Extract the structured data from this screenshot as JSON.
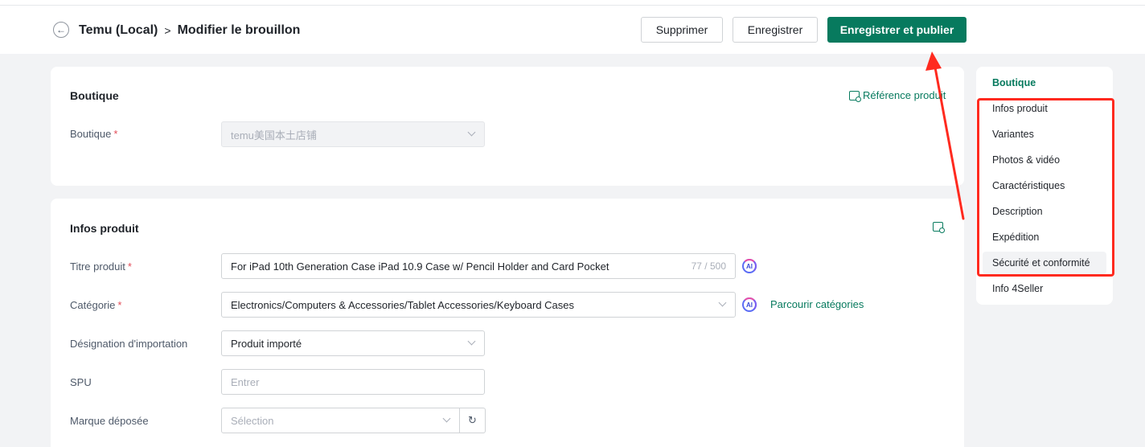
{
  "header": {
    "back_icon": "arrow-left-icon",
    "breadcrumb_root": "Temu (Local)",
    "breadcrumb_sep": ">",
    "page_title": "Modifier le brouillon",
    "delete_label": "Supprimer",
    "save_label": "Enregistrer",
    "publish_label": "Enregistrer et publier"
  },
  "boutique_section": {
    "title": "Boutique",
    "reference_link": "Référence produit",
    "shop_label": "Boutique",
    "required_mark": "*",
    "shop_value": "temu美国本土店铺"
  },
  "product_section": {
    "title": "Infos produit",
    "ai_label": "AI",
    "title_field": {
      "label": "Titre produit",
      "value": "For iPad 10th Generation Case iPad 10.9 Case w/ Pencil Holder and Card Pocket",
      "counter": "77 / 500"
    },
    "category_field": {
      "label": "Catégorie",
      "value": "Electronics/Computers & Accessories/Tablet Accessories/Keyboard Cases",
      "browse_link": "Parcourir catégories"
    },
    "import_field": {
      "label": "Désignation d'importation",
      "value": "Produit importé"
    },
    "spu_field": {
      "label": "SPU",
      "placeholder": "Entrer"
    },
    "brand_field": {
      "label": "Marque déposée",
      "placeholder": "Sélection"
    }
  },
  "side_nav": {
    "items": [
      {
        "label": "Boutique",
        "active": true
      },
      {
        "label": "Infos produit",
        "active": false
      },
      {
        "label": "Variantes",
        "active": false
      },
      {
        "label": "Photos & vidéo",
        "active": false
      },
      {
        "label": "Caractéristiques",
        "active": false
      },
      {
        "label": "Description",
        "active": false
      },
      {
        "label": "Expédition",
        "active": false
      },
      {
        "label": "Sécurité et conformité",
        "active": false
      },
      {
        "label": "Info 4Seller",
        "active": false
      }
    ]
  },
  "colors": {
    "accent": "#077a5e",
    "annotation": "#ff2a1f",
    "required": "#e34d59"
  }
}
